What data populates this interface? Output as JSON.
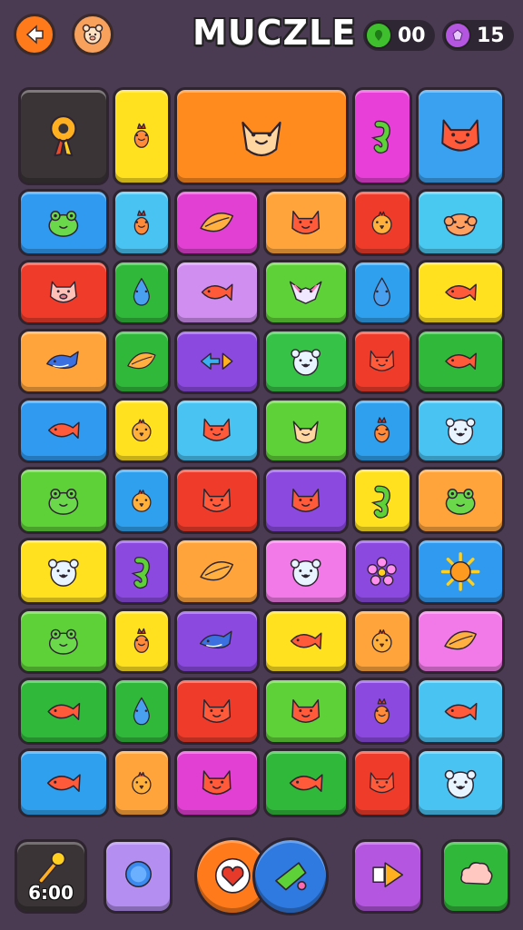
{
  "header": {
    "title": "MUCZLE",
    "coins": "00",
    "gems": "15",
    "back_icon": "back-arrow-icon",
    "pet_icon": "pet-face-icon"
  },
  "board": {
    "tiles": [
      {
        "name": "tile-golden-key",
        "color": "#3a3436",
        "icon": "key"
      },
      {
        "name": "tile-yellow-sprout",
        "color": "#ffe11f",
        "icon": "sprout"
      },
      {
        "name": "tile-orange-fox-trio",
        "color": "#ff8a1e",
        "icon": "fox"
      },
      {
        "name": "tile-magenta-seahorse",
        "color": "#e83fd8",
        "icon": "seahorse"
      },
      {
        "name": "tile-blue-red-cat",
        "color": "#3aa0f0",
        "icon": "cat"
      },
      {
        "name": "tile-blue-frog",
        "color": "#2f9af0",
        "icon": "frog"
      },
      {
        "name": "tile-sky-sprout",
        "color": "#49c3f2",
        "icon": "sprout"
      },
      {
        "name": "tile-magenta-leaf",
        "color": "#e23fd3",
        "icon": "leaf"
      },
      {
        "name": "tile-orange-bluecat",
        "color": "#ffa43a",
        "icon": "cat"
      },
      {
        "name": "tile-red-chick",
        "color": "#ee3b2a",
        "icon": "chick"
      },
      {
        "name": "tile-sky-elephant",
        "color": "#49c8f0",
        "icon": "blob"
      },
      {
        "name": "tile-red-pig",
        "color": "#ee3b2a",
        "icon": "pig"
      },
      {
        "name": "tile-green-drop",
        "color": "#30b83a",
        "icon": "drop"
      },
      {
        "name": "tile-lilac-fish",
        "color": "#cf8ef0",
        "icon": "fish"
      },
      {
        "name": "tile-green-bat",
        "color": "#5ed138",
        "icon": "bat"
      },
      {
        "name": "tile-blue-drop",
        "color": "#2fa0ee",
        "icon": "drop"
      },
      {
        "name": "tile-yellow-fish",
        "color": "#ffe11f",
        "icon": "fish"
      },
      {
        "name": "tile-orange-whale",
        "color": "#ffa43a",
        "icon": "whale"
      },
      {
        "name": "tile-green-leaf",
        "color": "#30b83a",
        "icon": "leaf"
      },
      {
        "name": "tile-purple-arrows",
        "color": "#8b49e0",
        "icon": "arrow"
      },
      {
        "name": "tile-green-polar",
        "color": "#36c246",
        "icon": "bear"
      },
      {
        "name": "tile-red-devil",
        "color": "#ee3b2a",
        "icon": "cat"
      },
      {
        "name": "tile-green-fish",
        "color": "#30b83a",
        "icon": "fish"
      },
      {
        "name": "tile-blue-tomato",
        "color": "#2f9af0",
        "icon": "fish"
      },
      {
        "name": "tile-yellow-chick",
        "color": "#ffe11f",
        "icon": "chick"
      },
      {
        "name": "tile-sky-cat",
        "color": "#49c3f2",
        "icon": "cat"
      },
      {
        "name": "tile-green-fox",
        "color": "#5ed138",
        "icon": "fox"
      },
      {
        "name": "tile-blue-sprout",
        "color": "#2fa0ee",
        "icon": "sprout"
      },
      {
        "name": "tile-sky-bear",
        "color": "#49c3f2",
        "icon": "bear"
      },
      {
        "name": "tile-green-frog",
        "color": "#5ed138",
        "icon": "frog"
      },
      {
        "name": "tile-blue-chick",
        "color": "#2fa0ee",
        "icon": "chick"
      },
      {
        "name": "tile-red-cat",
        "color": "#ee3b2a",
        "icon": "cat"
      },
      {
        "name": "tile-purple-cat",
        "color": "#8b49e0",
        "icon": "cat"
      },
      {
        "name": "tile-yellow-seahorse",
        "color": "#ffe11f",
        "icon": "seahorse"
      },
      {
        "name": "tile-orange-frog",
        "color": "#ffa43a",
        "icon": "frog"
      },
      {
        "name": "tile-yellow-hamster",
        "color": "#ffe11f",
        "icon": "bear"
      },
      {
        "name": "tile-purple-seahorse",
        "color": "#8b49e0",
        "icon": "seahorse"
      },
      {
        "name": "tile-orange-leaves",
        "color": "#ffa43a",
        "icon": "leaf"
      },
      {
        "name": "tile-pink-bear",
        "color": "#f279e8",
        "icon": "bear"
      },
      {
        "name": "tile-purple-flower",
        "color": "#8b49e0",
        "icon": "flower"
      },
      {
        "name": "tile-blue-sun",
        "color": "#2f9af0",
        "icon": "sun"
      },
      {
        "name": "tile-green-frog-2",
        "color": "#5ed138",
        "icon": "frog"
      },
      {
        "name": "tile-yellow-sprout-2",
        "color": "#ffe11f",
        "icon": "sprout"
      },
      {
        "name": "tile-purple-whale",
        "color": "#8b49e0",
        "icon": "whale"
      },
      {
        "name": "tile-yellow-redfish",
        "color": "#ffe11f",
        "icon": "fish"
      },
      {
        "name": "tile-orange-chick",
        "color": "#ffa43a",
        "icon": "chick"
      },
      {
        "name": "tile-pink-shell",
        "color": "#f279e8",
        "icon": "leaf"
      },
      {
        "name": "tile-green-fish-2",
        "color": "#30b83a",
        "icon": "fish"
      },
      {
        "name": "tile-green-bell",
        "color": "#30b83a",
        "icon": "drop"
      },
      {
        "name": "tile-red-cat-2",
        "color": "#ee3b2a",
        "icon": "cat"
      },
      {
        "name": "tile-green-bluecat",
        "color": "#5ed138",
        "icon": "cat"
      },
      {
        "name": "tile-purple-sprout",
        "color": "#8b49e0",
        "icon": "sprout"
      },
      {
        "name": "tile-sky-fish",
        "color": "#49c3f2",
        "icon": "fish"
      },
      {
        "name": "tile-blue-redfish",
        "color": "#2fa0ee",
        "icon": "fish"
      },
      {
        "name": "tile-orange-devil",
        "color": "#ffa43a",
        "icon": "chick"
      },
      {
        "name": "tile-magenta-cat",
        "color": "#e23fd3",
        "icon": "cat"
      },
      {
        "name": "tile-green-bluefish",
        "color": "#30b83a",
        "icon": "fish"
      },
      {
        "name": "tile-red-bluecat",
        "color": "#ee3b2a",
        "icon": "cat"
      },
      {
        "name": "tile-sky-hamster",
        "color": "#49c3f2",
        "icon": "bear"
      }
    ]
  },
  "toolbar": {
    "timer_label": "6:00",
    "buttons": [
      {
        "name": "timer-button",
        "color": "#3a3436",
        "icon": "hammer"
      },
      {
        "name": "shuffle-button",
        "color": "#b48ef0",
        "icon": "orb"
      },
      {
        "name": "heart-button",
        "color": "#ff7a1a",
        "icon": "heart"
      },
      {
        "name": "hint-button",
        "color": "#2f7ae0",
        "icon": "cone"
      },
      {
        "name": "play-button",
        "color": "#b556e0",
        "icon": "play"
      },
      {
        "name": "cloud-button",
        "color": "#30b83a",
        "icon": "cloud"
      }
    ]
  }
}
